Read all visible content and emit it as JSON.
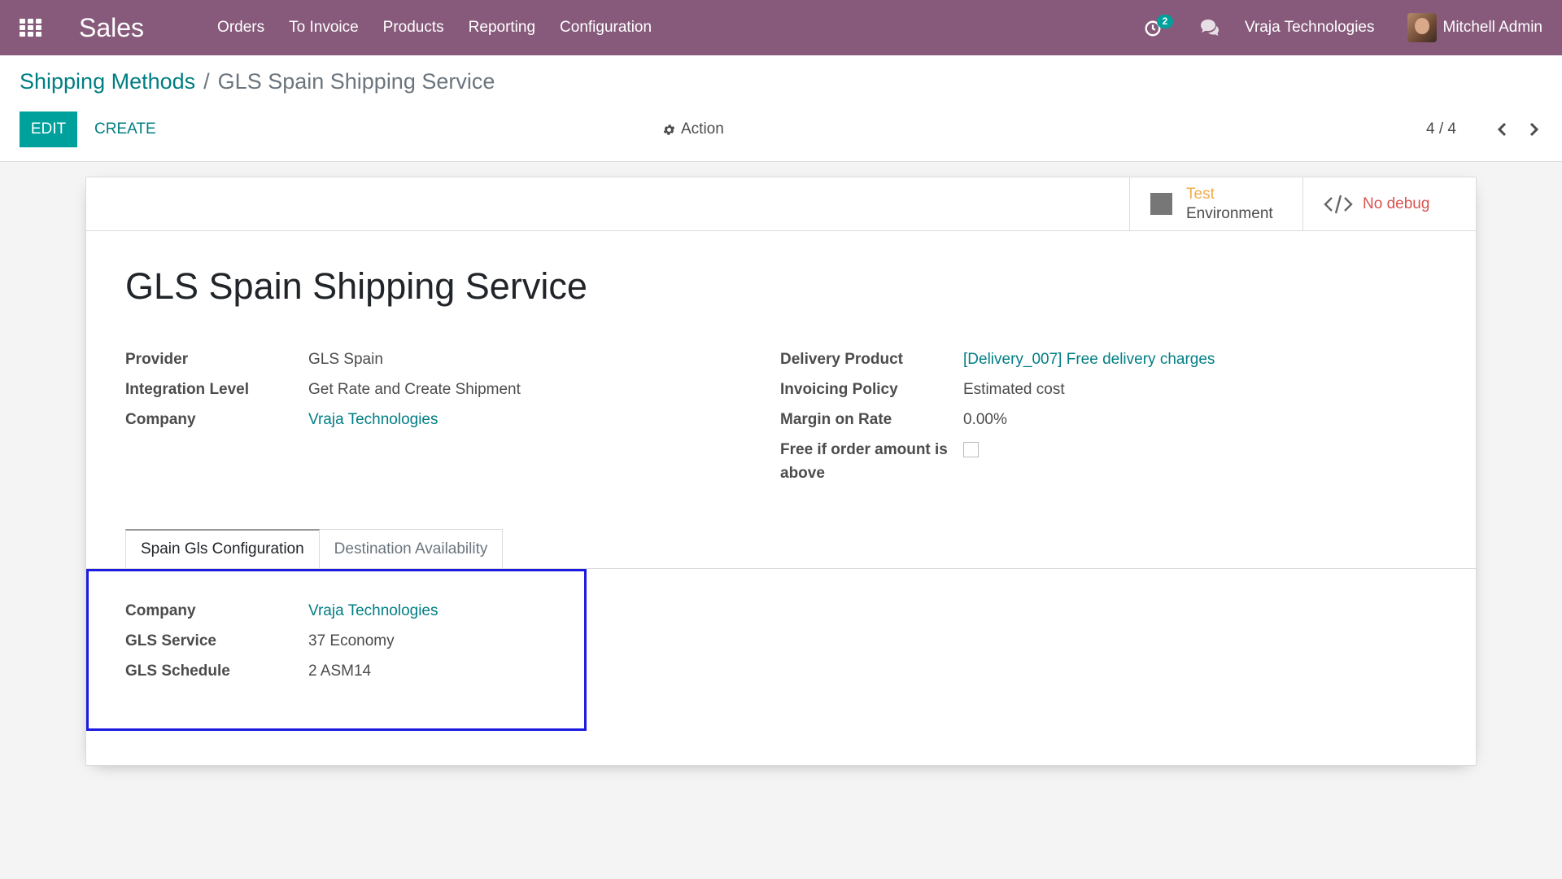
{
  "navbar": {
    "app_name": "Sales",
    "menu": [
      "Orders",
      "To Invoice",
      "Products",
      "Reporting",
      "Configuration"
    ],
    "activity_count": "2",
    "company": "Vraja Technologies",
    "user": "Mitchell Admin"
  },
  "breadcrumb": {
    "parent": "Shipping Methods",
    "separator": "/",
    "current": "GLS Spain Shipping Service"
  },
  "control_panel": {
    "edit_label": "EDIT",
    "create_label": "CREATE",
    "action_label": "Action",
    "pager": "4 / 4"
  },
  "button_box": {
    "env_test": "Test",
    "env_label": "Environment",
    "debug_label": "No debug"
  },
  "record": {
    "title": "GLS Spain Shipping Service",
    "left_fields": [
      {
        "label": "Provider",
        "value": "GLS Spain"
      },
      {
        "label": "Integration Level",
        "value": "Get Rate and Create Shipment"
      },
      {
        "label": "Company",
        "value": "Vraja Technologies"
      }
    ],
    "right_fields": [
      {
        "label": "Delivery Product",
        "value": "[Delivery_007] Free delivery charges"
      },
      {
        "label": "Invoicing Policy",
        "value": "Estimated cost"
      },
      {
        "label": "Margin on Rate",
        "value": "0.00%"
      },
      {
        "label": "Free if order amount is above",
        "value": false
      }
    ]
  },
  "tabs": [
    {
      "label": "Spain Gls Configuration",
      "active": true
    },
    {
      "label": "Destination Availability",
      "active": false
    }
  ],
  "tab_fields": [
    {
      "label": "Company",
      "value": "Vraja Technologies"
    },
    {
      "label": "GLS Service",
      "value": "37 Economy"
    },
    {
      "label": "GLS Schedule",
      "value": "2 ASM14"
    }
  ],
  "colors": {
    "navbar": "#875a7b",
    "primary": "#00a09d",
    "link": "#017e84",
    "highlight": "#1a1ae0"
  }
}
